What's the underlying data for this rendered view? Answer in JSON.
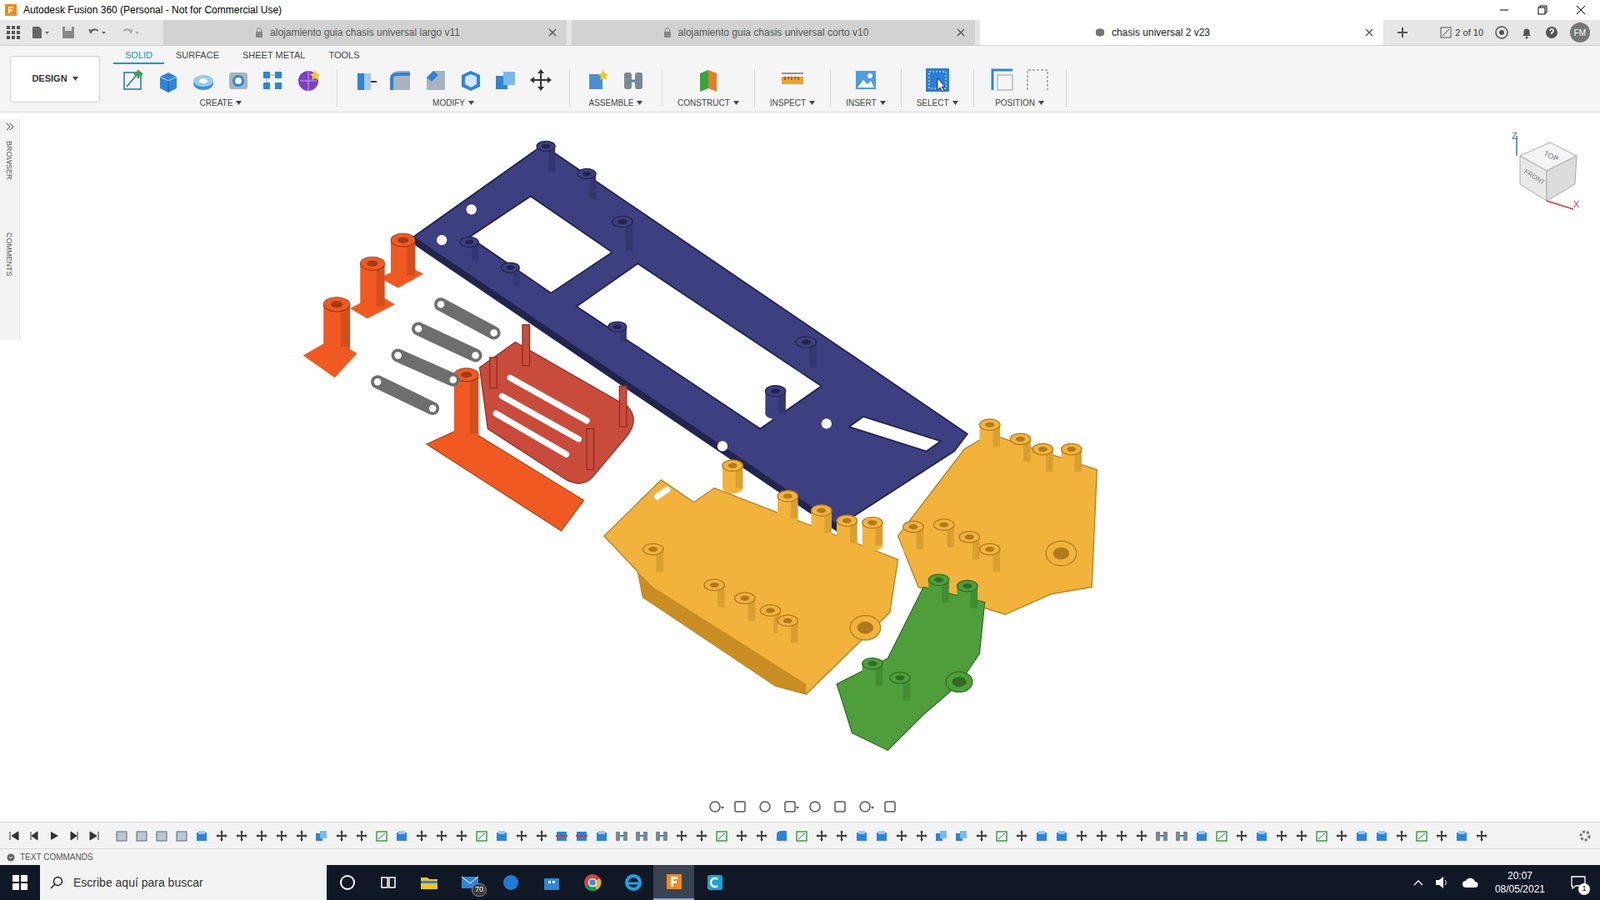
{
  "window": {
    "title": "Autodesk Fusion 360 (Personal - Not for Commercial Use)"
  },
  "document_tabs": [
    {
      "label": "alojamiento guia chasis universal largo v11",
      "selected": false,
      "locked": true
    },
    {
      "label": "alojamiento guia chasis universal corto v10",
      "selected": false,
      "locked": true
    },
    {
      "label": "chasis universal 2 v23",
      "selected": true,
      "locked": false
    }
  ],
  "tab_counter": "2 of 10",
  "user_initials": "FM",
  "workspace": "DESIGN",
  "toolbar_tabs": [
    {
      "label": "SOLID",
      "selected": true
    },
    {
      "label": "SURFACE",
      "selected": false
    },
    {
      "label": "SHEET METAL",
      "selected": false
    },
    {
      "label": "TOOLS",
      "selected": false
    }
  ],
  "tool_groups": [
    {
      "label": "CREATE",
      "tools": [
        "sketch",
        "extrude",
        "revolve",
        "hole",
        "pattern",
        "form"
      ]
    },
    {
      "label": "MODIFY",
      "tools": [
        "presspull",
        "fillet",
        "chamfer",
        "shell",
        "combine",
        "move"
      ]
    },
    {
      "label": "ASSEMBLE",
      "tools": [
        "component",
        "joint"
      ]
    },
    {
      "label": "CONSTRUCT",
      "tools": [
        "plane"
      ]
    },
    {
      "label": "INSPECT",
      "tools": [
        "measure"
      ]
    },
    {
      "label": "INSERT",
      "tools": [
        "image"
      ]
    },
    {
      "label": "SELECT",
      "tools": [
        "select"
      ]
    },
    {
      "label": "POSITION",
      "tools": [
        "capture",
        "revert"
      ]
    }
  ],
  "side_panel": [
    "BROWSER",
    "COMMENTS"
  ],
  "view_cube": {
    "top": "TOP",
    "front": "FRONT",
    "z": "Z",
    "x": "X"
  },
  "model": {
    "parts": [
      {
        "kind": "chassis",
        "color": "#3d3f80"
      },
      {
        "kind": "posts",
        "color": "#f05a22"
      },
      {
        "kind": "links",
        "color": "#6e6e6e"
      },
      {
        "kind": "guide",
        "color": "#c94b3c"
      },
      {
        "kind": "bracket-large",
        "color": "#f2b33d"
      },
      {
        "kind": "bracket-right",
        "color": "#f2b33d"
      },
      {
        "kind": "bracket-small",
        "color": "#4e9e3b"
      }
    ]
  },
  "timeline": {
    "features": [
      "body",
      "body",
      "body",
      "body",
      "extrude",
      "move",
      "move",
      "move",
      "move",
      "move",
      "combine",
      "move",
      "move",
      "sketch",
      "extrude",
      "move",
      "move",
      "move",
      "sketch",
      "extrude",
      "move",
      "move",
      "split",
      "split",
      "extrude",
      "joint",
      "joint",
      "joint",
      "move",
      "move",
      "sketch",
      "move",
      "move",
      "fillet",
      "sketch",
      "move",
      "move",
      "extrude",
      "extrude",
      "move",
      "move",
      "combine",
      "combine",
      "move",
      "sketch",
      "move",
      "extrude",
      "extrude",
      "move",
      "move",
      "move",
      "move",
      "joint",
      "joint",
      "extrude",
      "sketch",
      "move",
      "extrude",
      "move",
      "move",
      "sketch",
      "move",
      "extrude",
      "extrude",
      "move",
      "sketch",
      "move",
      "extrude",
      "move"
    ]
  },
  "text_commands": "TEXT COMMANDS",
  "taskbar": {
    "search_placeholder": "Escribe aquí para buscar",
    "apps": [
      {
        "kind": "cortana",
        "selected": false,
        "badge": ""
      },
      {
        "kind": "taskview",
        "selected": false,
        "badge": ""
      },
      {
        "kind": "explorer",
        "selected": false,
        "badge": ""
      },
      {
        "kind": "mail",
        "selected": false,
        "badge": "70"
      },
      {
        "kind": "edge",
        "selected": false,
        "badge": ""
      },
      {
        "kind": "store",
        "selected": false,
        "badge": ""
      },
      {
        "kind": "chrome",
        "selected": false,
        "badge": ""
      },
      {
        "kind": "ie",
        "selected": false,
        "badge": ""
      },
      {
        "kind": "fusion",
        "selected": true,
        "badge": ""
      },
      {
        "kind": "other",
        "selected": false,
        "badge": ""
      }
    ],
    "time": "20:07",
    "date": "08/05/2021",
    "notifications": "1"
  }
}
